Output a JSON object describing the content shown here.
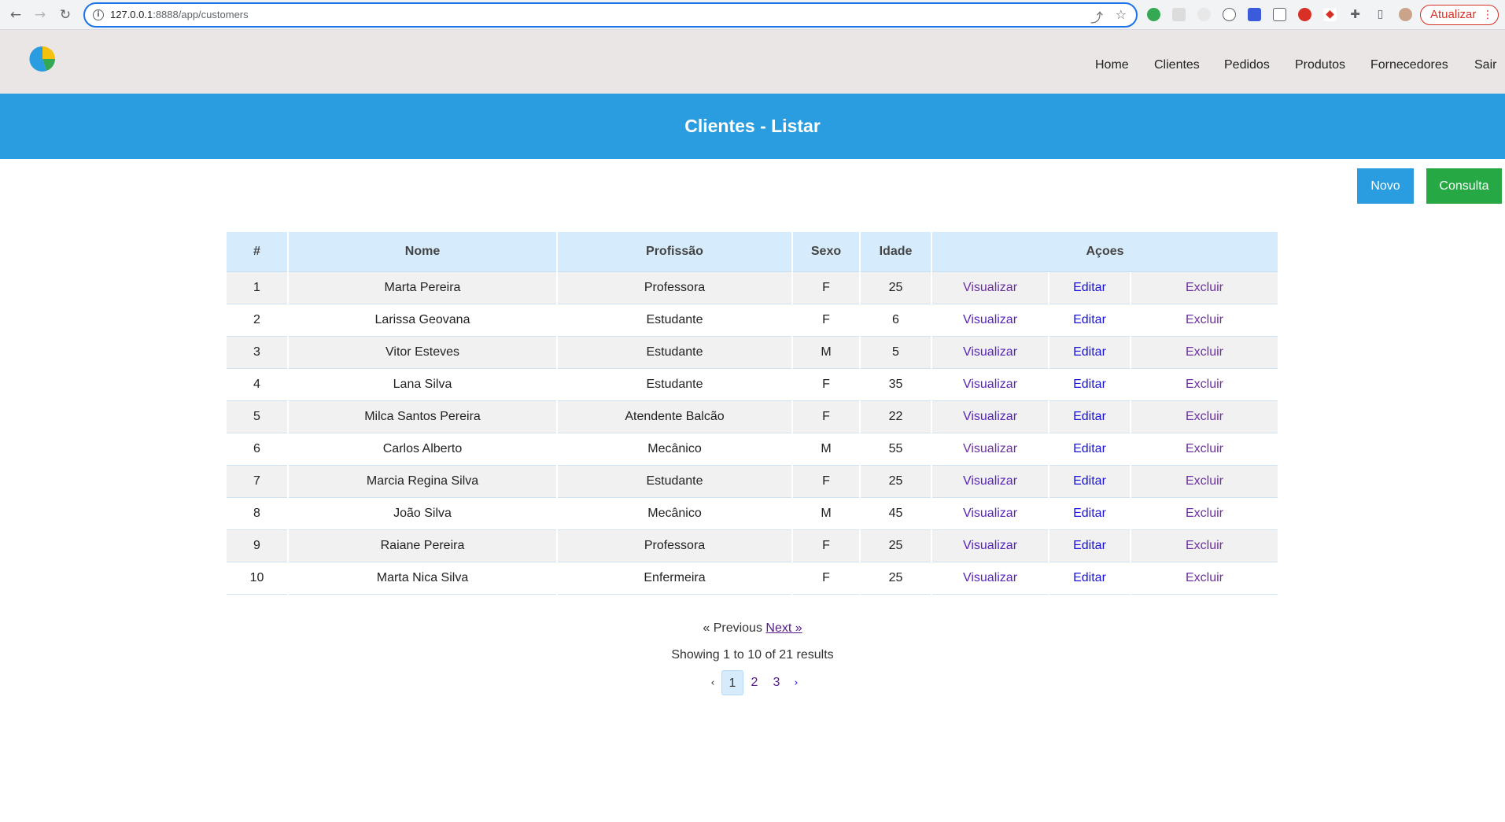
{
  "browser": {
    "url_host": "127.0.0.1",
    "url_rest": ":8888/app/customers",
    "update_label": "Atualizar",
    "menu_dots": "⋮"
  },
  "nav": {
    "links": [
      "Home",
      "Clientes",
      "Pedidos",
      "Produtos",
      "Fornecedores",
      "Sair"
    ]
  },
  "page": {
    "title": "Clientes - Listar"
  },
  "actions": {
    "new_label": "Novo",
    "query_label": "Consulta"
  },
  "table": {
    "headers": {
      "id": "#",
      "name": "Nome",
      "profession": "Profissão",
      "sex": "Sexo",
      "age": "Idade",
      "actions": "Açoes"
    },
    "action_labels": {
      "view": "Visualizar",
      "edit": "Editar",
      "delete": "Excluir"
    },
    "rows": [
      {
        "id": "1",
        "name": "Marta Pereira",
        "profession": "Professora",
        "sex": "F",
        "age": "25"
      },
      {
        "id": "2",
        "name": "Larissa Geovana",
        "profession": "Estudante",
        "sex": "F",
        "age": "6"
      },
      {
        "id": "3",
        "name": "Vitor Esteves",
        "profession": "Estudante",
        "sex": "M",
        "age": "5"
      },
      {
        "id": "4",
        "name": "Lana Silva",
        "profession": "Estudante",
        "sex": "F",
        "age": "35"
      },
      {
        "id": "5",
        "name": "Milca Santos Pereira",
        "profession": "Atendente Balcão",
        "sex": "F",
        "age": "22"
      },
      {
        "id": "6",
        "name": "Carlos Alberto",
        "profession": "Mecânico",
        "sex": "M",
        "age": "55"
      },
      {
        "id": "7",
        "name": "Marcia Regina Silva",
        "profession": "Estudante",
        "sex": "F",
        "age": "25"
      },
      {
        "id": "8",
        "name": "João Silva",
        "profession": "Mecânico",
        "sex": "M",
        "age": "45"
      },
      {
        "id": "9",
        "name": "Raiane Pereira",
        "profession": "Professora",
        "sex": "F",
        "age": "25"
      },
      {
        "id": "10",
        "name": "Marta Nica Silva",
        "profession": "Enfermeira",
        "sex": "F",
        "age": "25"
      }
    ]
  },
  "pagination": {
    "previous": "« Previous",
    "next": "Next »",
    "showing": "Showing 1 to 10 of 21 results",
    "prev_arrow": "‹",
    "next_arrow": "›",
    "pages": [
      "1",
      "2",
      "3"
    ],
    "current": "1"
  },
  "colors": {
    "title_band": "#2a9de1",
    "new_button": "#2a9de1",
    "query_button": "#26a844",
    "table_header": "#d6ebfb"
  }
}
